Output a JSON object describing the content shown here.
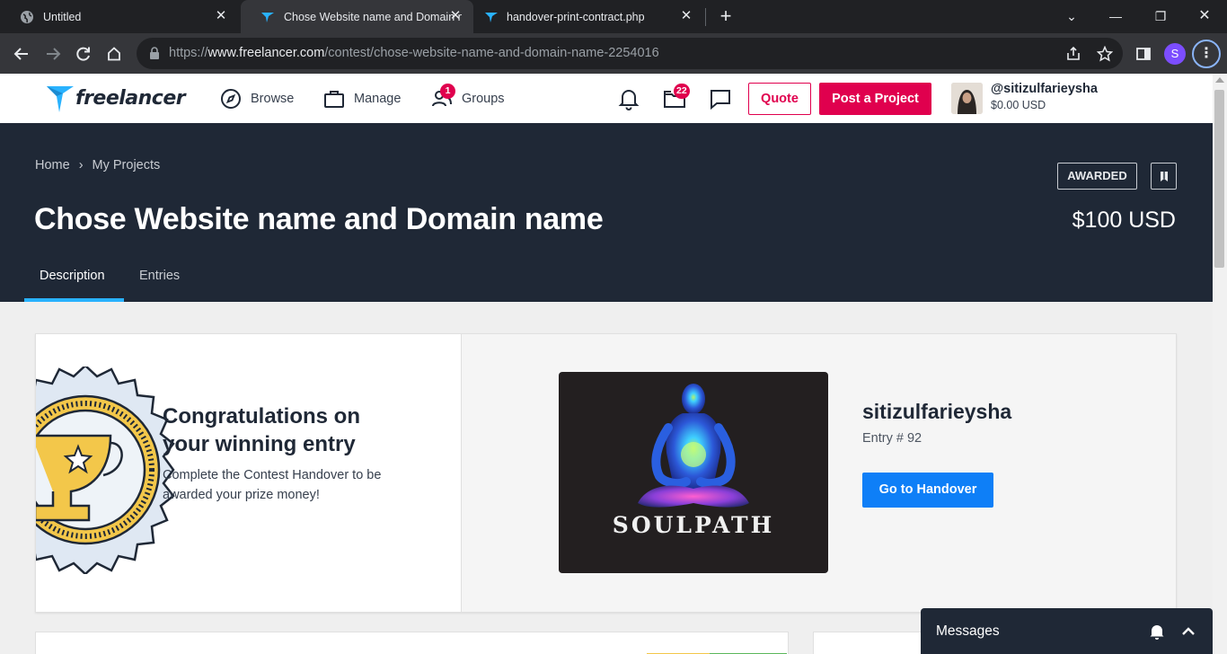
{
  "browser": {
    "tabs": [
      {
        "title": "Untitled",
        "icon": "globe-icon",
        "active": false
      },
      {
        "title": "Chose Website name and Domain na",
        "icon": "freelancer-bird-icon",
        "active": true
      },
      {
        "title": "handover-print-contract.php",
        "icon": "freelancer-bird-icon",
        "active": false
      }
    ],
    "new_tab_symbol": "+",
    "url_scheme": "https://",
    "url_domain": "www.freelancer.com",
    "url_path": "/contest/chose-website-name-and-domain-name-2254016",
    "profile_initial": "S",
    "profile_color": "#7c4dff"
  },
  "nav": {
    "logo_text": "freelancer",
    "browse_label": "Browse",
    "manage_label": "Manage",
    "groups_label": "Groups",
    "groups_badge": "1",
    "projects_badge": "22",
    "quote_label": "Quote",
    "post_project_label": "Post a Project",
    "username": "@sitizulfarieysha",
    "balance": "$0.00 USD",
    "accent_color": "#e0004e"
  },
  "hero": {
    "breadcrumb": [
      "Home",
      "My Projects"
    ],
    "breadcrumb_sep": "›",
    "title": "Chose Website name and Domain name",
    "status": "AWARDED",
    "price": "$100 USD",
    "tabs": [
      "Description",
      "Entries"
    ],
    "active_tab": "Description",
    "bg_color": "#1f2836",
    "tab_accent": "#29b2fe"
  },
  "award_card": {
    "title": "Congratulations on your winning entry",
    "text": "Complete the Contest Handover to be awarded your prize money!",
    "entrant": "sitizulfarieysha",
    "entry_number": "Entry # 92",
    "entry_image_word": "SOULPATH",
    "handover_button": "Go to Handover",
    "button_color": "#0e7ff7"
  },
  "messages": {
    "label": "Messages"
  }
}
